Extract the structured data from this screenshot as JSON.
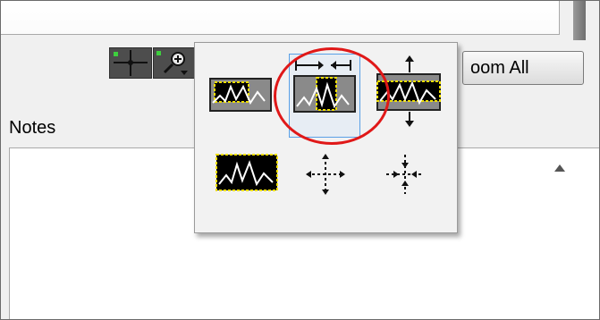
{
  "toolbar": {
    "zoom_all_label": "oom All",
    "crosshair_tool": "crosshair-icon",
    "zoom_tool": "zoom-icon"
  },
  "notes": {
    "label": "Notes",
    "value": ""
  },
  "zoom_palette": {
    "options": [
      {
        "icon": "zoom-rectangle-icon"
      },
      {
        "icon": "zoom-x-icon",
        "selected": true
      },
      {
        "icon": "zoom-y-icon"
      },
      {
        "icon": "zoom-fit-icon"
      },
      {
        "icon": "zoom-in-about-point-icon"
      },
      {
        "icon": "zoom-out-about-point-icon"
      }
    ]
  },
  "colors": {
    "highlight": "#e01818",
    "selection": "#5aa0e6",
    "graph_bg": "#000000",
    "graph_border": "#f0e000"
  }
}
